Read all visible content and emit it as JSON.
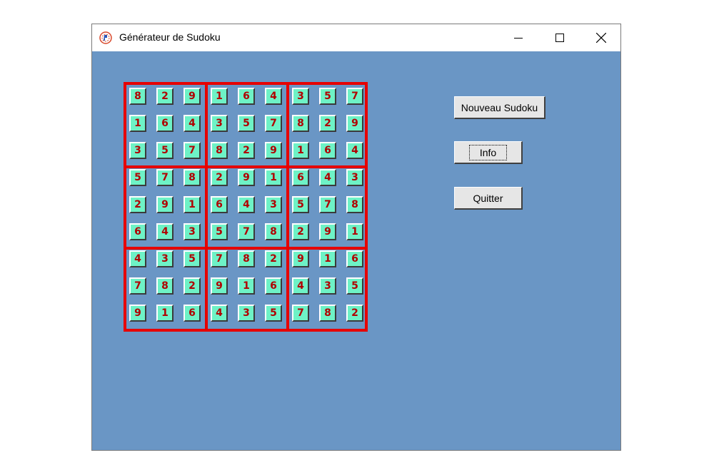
{
  "window": {
    "title": "Générateur de Sudoku",
    "controls": {
      "minimize": "minimize-icon",
      "maximize": "maximize-icon",
      "close": "close-icon"
    }
  },
  "buttons": {
    "new_sudoku": "Nouveau Sudoku",
    "info": "Info",
    "quit": "Quitter"
  },
  "grid": [
    [
      "8",
      "2",
      "9",
      "1",
      "6",
      "4",
      "3",
      "5",
      "7"
    ],
    [
      "1",
      "6",
      "4",
      "3",
      "5",
      "7",
      "8",
      "2",
      "9"
    ],
    [
      "3",
      "5",
      "7",
      "8",
      "2",
      "9",
      "1",
      "6",
      "4"
    ],
    [
      "5",
      "7",
      "8",
      "2",
      "9",
      "1",
      "6",
      "4",
      "3"
    ],
    [
      "2",
      "9",
      "1",
      "6",
      "4",
      "3",
      "5",
      "7",
      "8"
    ],
    [
      "6",
      "4",
      "3",
      "5",
      "7",
      "8",
      "2",
      "9",
      "1"
    ],
    [
      "4",
      "3",
      "5",
      "7",
      "8",
      "2",
      "9",
      "1",
      "6"
    ],
    [
      "7",
      "8",
      "2",
      "9",
      "1",
      "6",
      "4",
      "3",
      "5"
    ],
    [
      "9",
      "1",
      "6",
      "4",
      "3",
      "5",
      "7",
      "8",
      "2"
    ]
  ],
  "colors": {
    "background": "#6a96c5",
    "grid_lines": "#e60000",
    "cell_fill": "#6ef2c6",
    "digit": "#b00000"
  }
}
